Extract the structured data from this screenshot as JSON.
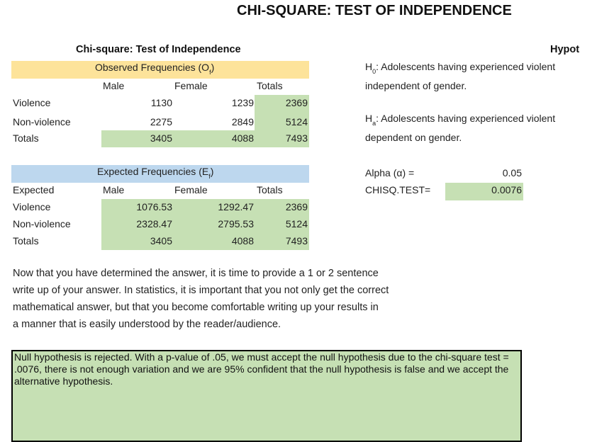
{
  "title": "CHI-SQUARE: TEST OF INDEPENDENCE",
  "sheet_subtitle": "Chi-square: Test of Independence",
  "hypothesis_header": "Hypot",
  "observed": {
    "header": "Observed Frequencies (O",
    "header_sub": "f",
    "header_close": ")",
    "col_male": "Male",
    "col_female": "Female",
    "col_totals": "Totals",
    "rows": [
      {
        "label": "Violence",
        "male": "1130",
        "female": "1239",
        "total": "2369"
      },
      {
        "label": "Non-violence",
        "male": "2275",
        "female": "2849",
        "total": "5124"
      },
      {
        "label": "Totals",
        "male": "3405",
        "female": "4088",
        "total": "7493"
      }
    ]
  },
  "expected": {
    "header": "Expected Frequencies (E",
    "header_sub": "f",
    "header_close": ")",
    "row_header": "Expected",
    "col_male": "Male",
    "col_female": "Female",
    "col_totals": "Totals",
    "rows": [
      {
        "label": "Violence",
        "male": "1076.53",
        "female": "1292.47",
        "total": "2369"
      },
      {
        "label": "Non-violence",
        "male": "2328.47",
        "female": "2795.53",
        "total": "5124"
      },
      {
        "label": "Totals",
        "male": "3405",
        "female": "4088",
        "total": "7493"
      }
    ]
  },
  "hypotheses": {
    "h0_letter": "H",
    "h0_sub": "0",
    "h0_line1": ": Adolescents having experienced violent",
    "h0_line2": "independent of gender.",
    "ha_letter": "H",
    "ha_sub": "a",
    "ha_line1": ": Adolescents having experienced violent",
    "ha_line2": "dependent on gender."
  },
  "alpha": {
    "label": "Alpha (α) =",
    "value": "0.05"
  },
  "chisq": {
    "label": "CHISQ.TEST=",
    "value": "0.0076"
  },
  "instructions": [
    "Now that you have determined the answer, it is time to provide a 1 or 2 sentence",
    "write up of your answer. In statistics, it is important that you not only get the correct",
    "mathematical answer, but that you become comfortable writing up your results in",
    "a manner that is easily understood by the reader/audience."
  ],
  "answer_text": "Null hypothesis is rejected.  With a p-value of .05, we must accept the null hypothesis due to the chi-square test = .0076, there is not enough variation and we are 95% confident that the null hypothesis is false and we accept the alternative hypothesis."
}
